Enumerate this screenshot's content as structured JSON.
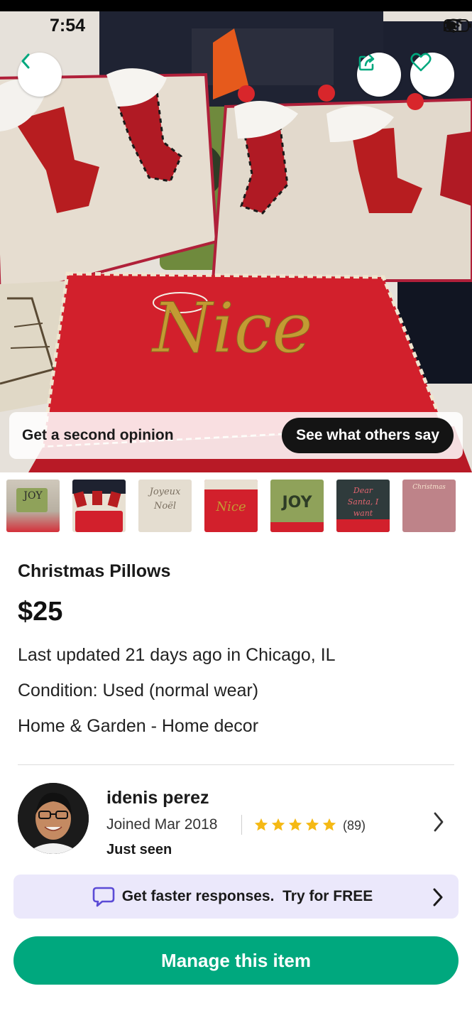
{
  "status_bar": {
    "time": "7:54"
  },
  "hero": {
    "opinion_text": "Get a second opinion",
    "opinion_button": "See what others say",
    "photo_text": "Nice"
  },
  "thumbnails": [
    {
      "text": "JOY"
    },
    {
      "text": ""
    },
    {
      "text": "Joyeux Noël"
    },
    {
      "text": "Nice"
    },
    {
      "text": "JOY"
    },
    {
      "text": "Dear Santa, I want"
    },
    {
      "text": "Christmas"
    }
  ],
  "listing": {
    "title": "Christmas Pillows",
    "price": "$25",
    "updated": "Last updated 21 days ago in Chicago, IL",
    "condition": "Condition: Used (normal wear)",
    "category": "Home & Garden - Home decor"
  },
  "seller": {
    "name": "idenis perez",
    "joined": "Joined Mar 2018",
    "rating_count": "(89)",
    "rating_stars": 5,
    "last_seen": "Just seen"
  },
  "promo": {
    "text": "Get faster responses.  Try for FREE"
  },
  "cta": {
    "label": "Manage this item"
  },
  "colors": {
    "accent": "#00a87e",
    "promo_bg": "#ebe8fb",
    "promo_icon": "#5b4bd6",
    "star": "#f5b914"
  }
}
